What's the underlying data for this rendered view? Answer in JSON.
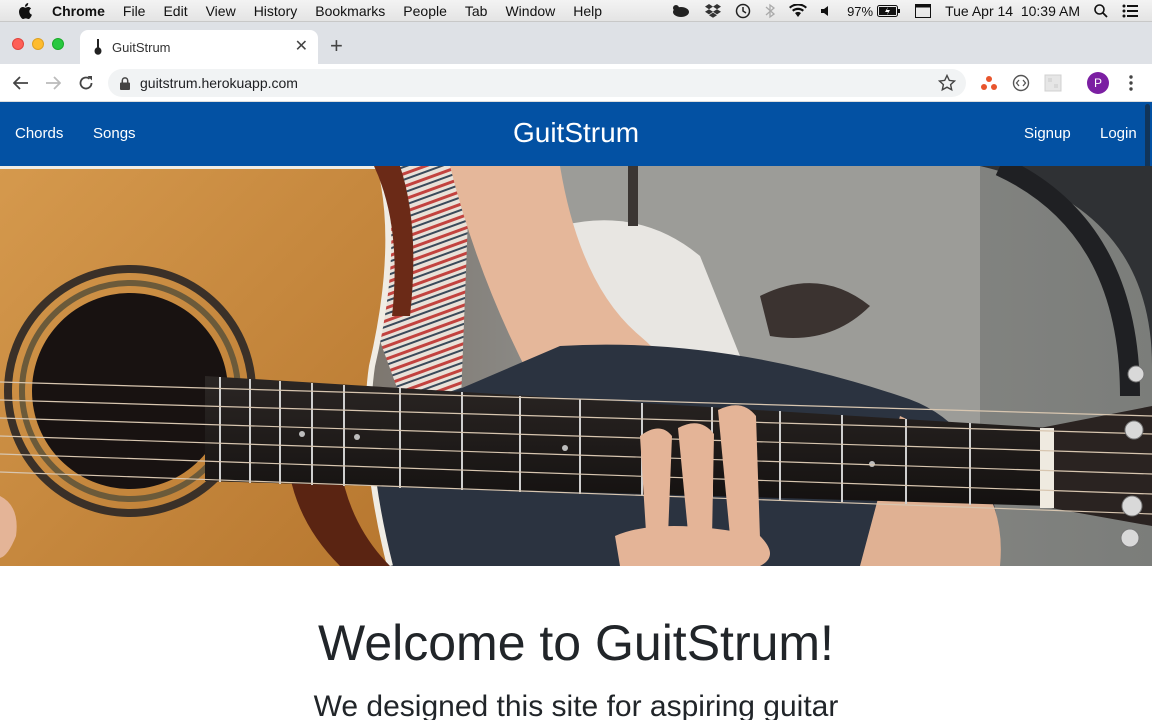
{
  "menubar": {
    "app": "Chrome",
    "items": [
      "File",
      "Edit",
      "View",
      "History",
      "Bookmarks",
      "People",
      "Tab",
      "Window",
      "Help"
    ],
    "battery": "97%",
    "datetime": "Tue Apr 14  10:39 AM"
  },
  "browser": {
    "tab_title": "GuitStrum",
    "url": "guitstrum.herokuapp.com",
    "profile_initial": "P"
  },
  "site": {
    "nav_left": [
      "Chords",
      "Songs"
    ],
    "brand": "GuitStrum",
    "nav_right": [
      "Signup",
      "Login"
    ],
    "brand_color": "#0351a3"
  },
  "content": {
    "heading": "Welcome to GuitStrum!",
    "subheading": "We designed this site for aspiring guitar"
  },
  "icons": [
    "apple-icon",
    "finder-icon",
    "dropbox-icon",
    "time-machine-icon",
    "bluetooth-icon",
    "wifi-icon",
    "volume-icon",
    "battery-icon",
    "calendar-icon",
    "spotlight-icon",
    "control-center-icon",
    "back-icon",
    "forward-icon",
    "reload-icon",
    "lock-icon",
    "bookmark-star-icon",
    "menu-dots-icon"
  ]
}
